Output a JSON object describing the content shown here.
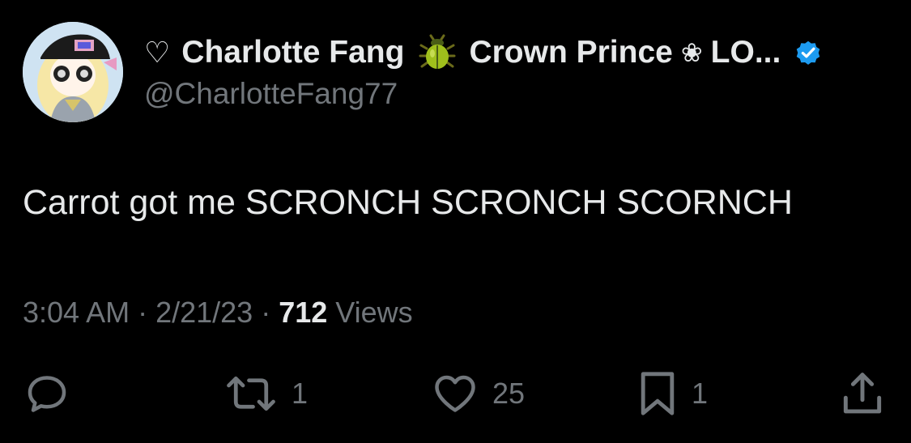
{
  "author": {
    "heart_glyph": "♡",
    "name": "Charlotte Fang",
    "beetle_icon": "beetle-emoji",
    "title_rest": "Crown Prince",
    "flower_glyph": "❀",
    "title_tail": "LO...",
    "verified_color": "#1d9bf0",
    "handle": "@CharlotteFang77"
  },
  "tweet": {
    "text": "Carrot got me SCRONCH SCRONCH SCORNCH"
  },
  "meta": {
    "time": "3:04 AM",
    "separator1": " · ",
    "date": "2/21/23",
    "separator2": " · ",
    "views_count": "712",
    "views_label": " Views"
  },
  "actions": {
    "reply_count": "",
    "retweet_count": "1",
    "like_count": "25",
    "bookmark_count": "1"
  },
  "colors": {
    "background": "#000000",
    "primary_text": "#e7e9ea",
    "secondary_text": "#71767b",
    "accent": "#1d9bf0"
  }
}
